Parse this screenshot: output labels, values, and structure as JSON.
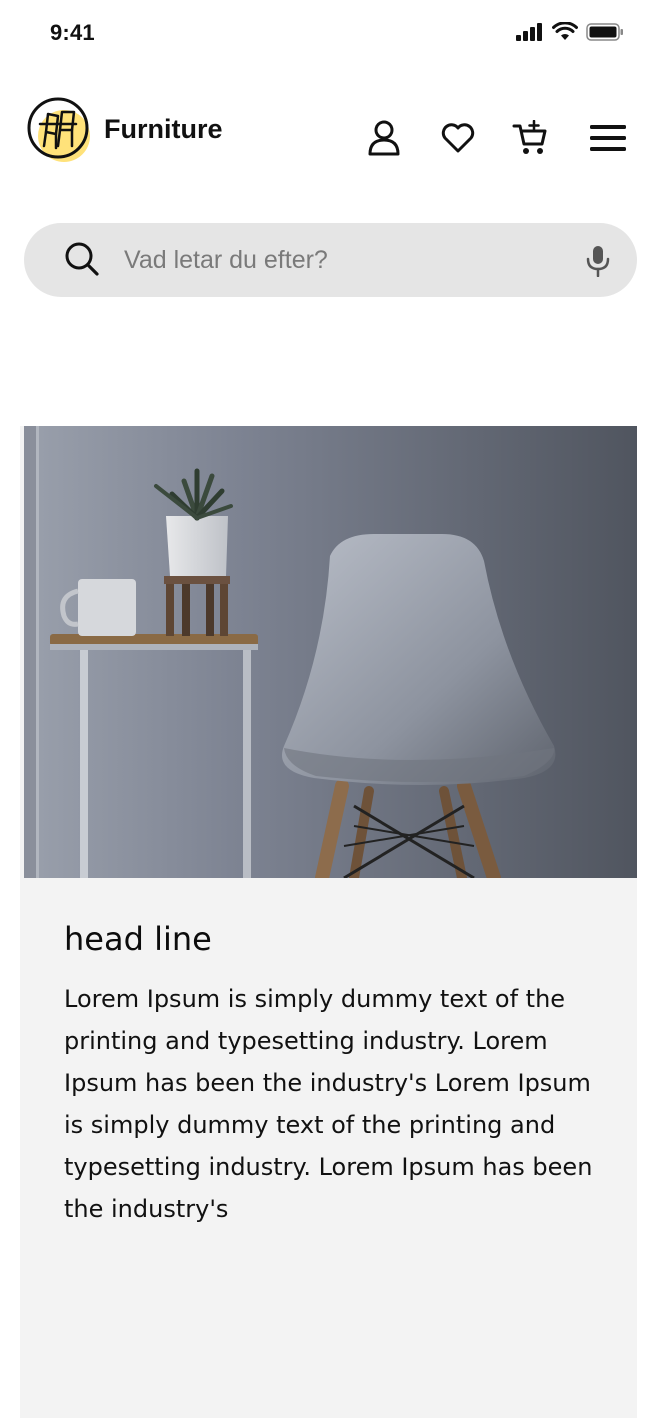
{
  "status_bar": {
    "time": "9:41",
    "icons": [
      "signal-icon",
      "wifi-icon",
      "battery-icon"
    ]
  },
  "header": {
    "brand": "Furniture",
    "logo": "chair-logo",
    "logo_accent": "#ffe27a",
    "icons": [
      "user-icon",
      "heart-icon",
      "cart-add-icon",
      "menu-icon"
    ]
  },
  "search": {
    "placeholder": "Vad letar du efter?",
    "value": "",
    "icon": "search-icon",
    "voice_icon": "microphone-icon"
  },
  "card": {
    "image_alt": "Grey chair beside side table",
    "headline": "head line",
    "body": "Lorem Ipsum is simply dummy text of the printing and typesetting industry. Lorem Ipsum has been the industry's Lorem Ipsum is simply dummy text of the printing and typesetting industry. Lorem Ipsum has been the industry's",
    "background": "#f3f3f3"
  }
}
